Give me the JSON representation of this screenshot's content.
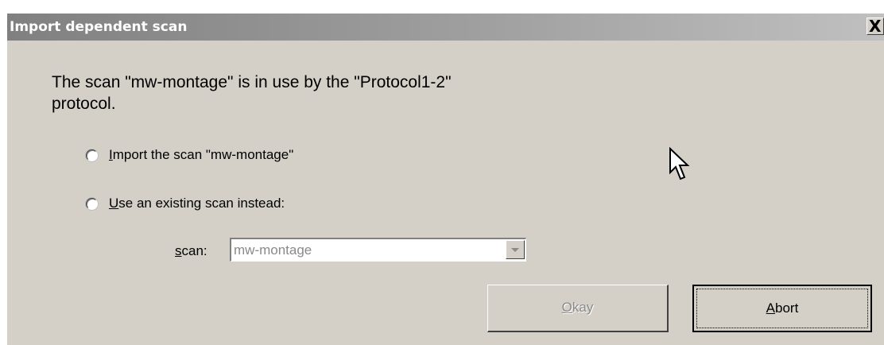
{
  "window": {
    "title": "Import dependent scan",
    "close_label": "X"
  },
  "message": {
    "line1": "The scan \"mw-montage\" is in use by the \"Protocol1-2\"",
    "line2": "protocol."
  },
  "options": {
    "import_mnemonic": "I",
    "import_rest": "mport the scan \"mw-montage\"",
    "existing_mnemonic": "U",
    "existing_rest": "se an existing scan instead:"
  },
  "scan": {
    "label_mnemonic": "s",
    "label_rest": "can:",
    "value": "mw-montage",
    "icon": "chevron-down-icon"
  },
  "buttons": {
    "okay_mnemonic": "O",
    "okay_rest": "kay",
    "abort_mnemonic": "A",
    "abort_rest": "bort"
  },
  "colors": {
    "dialog_bg": "#d4d0c8",
    "titlebar_start": "#808080",
    "titlebar_end": "#c0c0c0",
    "disabled_text": "#8a8a8a"
  }
}
